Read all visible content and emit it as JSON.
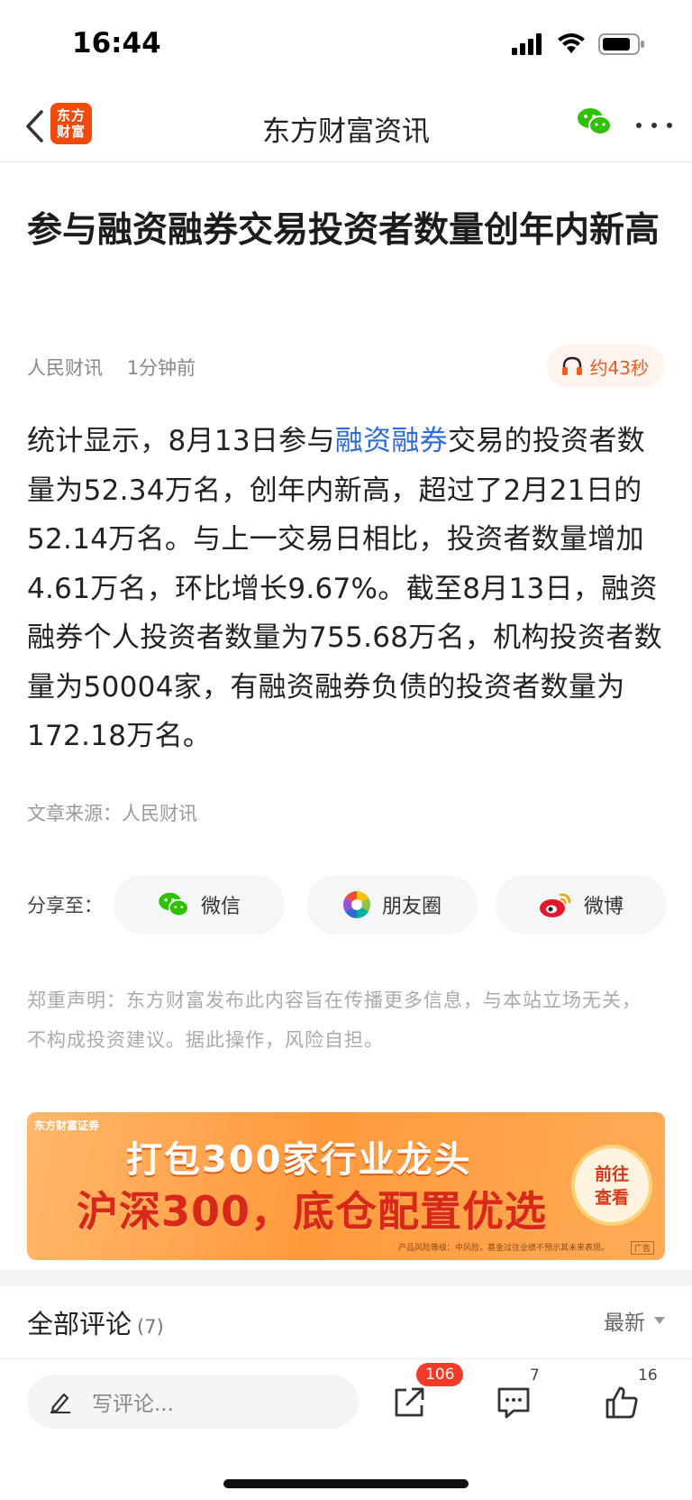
{
  "status_bar": {
    "time": "16:44"
  },
  "nav": {
    "logo_line1": "东方",
    "logo_line2": "财富",
    "title": "东方财富资讯"
  },
  "article": {
    "title": "参与融资融券交易投资者数量创年内新高",
    "source_name": "人民财讯",
    "time_ago": "1分钟前",
    "audio_label": "约43秒",
    "body_before_link": "统计显示，8月13日参与",
    "body_link": "融资融券",
    "body_after_link": "交易的投资者数量为52.34万名，创年内新高，超过了2月21日的52.14万名。与上一交易日相比，投资者数量增加4.61万名，环比增长9.67%。截至8月13日，融资融券个人投资者数量为755.68万名，机构投资者数量为50004家，有融资融券负债的投资者数量为172.18万名。",
    "source_line": "文章来源：人民财讯"
  },
  "share": {
    "label": "分享至：",
    "wechat": "微信",
    "moments": "朋友圈",
    "weibo": "微博"
  },
  "disclaimer": "郑重声明：东方财富发布此内容旨在传播更多信息，与本站立场无关，不构成投资建议。据此操作，风险自担。",
  "banner": {
    "brand": "东方财富证券",
    "line1": "打包300家行业龙头",
    "line2": "沪深300，底仓配置优选",
    "cta_line1": "前往",
    "cta_line2": "查看",
    "risk_note": "产品风险等级：中风险，基金过往业绩不预示其未来表现。",
    "ad_tag": "广告"
  },
  "comments": {
    "title": "全部评论",
    "count": "(7)",
    "sort": "最新"
  },
  "bottom_bar": {
    "comment_placeholder": "写评论...",
    "share_count": "106",
    "comment_count": "7",
    "like_count": "16"
  },
  "colors": {
    "accent_orange": "#f04a0c",
    "link_blue": "#2f6bd6",
    "badge_red": "#f03a2a",
    "wechat_green": "#2dc100"
  }
}
